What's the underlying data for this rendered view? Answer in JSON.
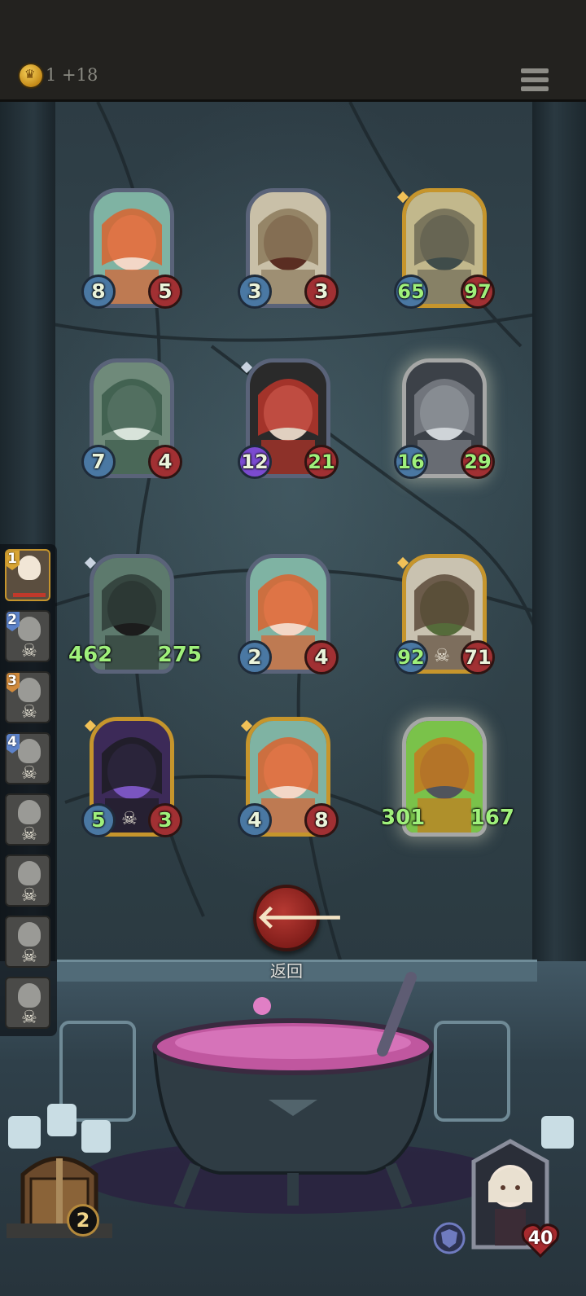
{
  "header": {
    "gold_text": "1 +18"
  },
  "board": {
    "rows": [
      [
        {
          "name": "siren-sorceress",
          "frame": "silver",
          "attack": "8",
          "health": "5"
        },
        {
          "name": "airship-bombardment",
          "frame": "silver",
          "attack": "3",
          "health": "3"
        },
        {
          "name": "kraken-shipwreck",
          "frame": "gold",
          "attack": "65",
          "health": "97"
        }
      ],
      [
        {
          "name": "horned-elf-sorceress",
          "frame": "silver",
          "attack": "7",
          "health": "4"
        },
        {
          "name": "hooded-assassin",
          "frame": "silver",
          "attack": "12",
          "health": "21"
        },
        {
          "name": "armored-gargoyle",
          "frame": "glowing",
          "attack": "16",
          "health": "29"
        }
      ],
      [
        {
          "name": "iron-knight-golem",
          "frame": "silver",
          "attack": "462",
          "health": "275"
        },
        {
          "name": "siren-sorceress",
          "frame": "silver",
          "attack": "2",
          "health": "4"
        },
        {
          "name": "old-hag",
          "frame": "gold",
          "attack": "92",
          "health": "71"
        }
      ],
      [
        {
          "name": "shadow-wraith",
          "frame": "gold",
          "attack": "5",
          "health": "3"
        },
        {
          "name": "siren-sorceress",
          "frame": "gold",
          "attack": "4",
          "health": "8"
        },
        {
          "name": "pumpkin-golem",
          "frame": "glowing",
          "attack": "301",
          "health": "167"
        }
      ]
    ]
  },
  "queue": [
    {
      "number": "1",
      "active": true
    },
    {
      "number": "2",
      "active": false
    },
    {
      "number": "3",
      "active": false
    },
    {
      "number": "4",
      "active": false
    },
    {
      "number": "",
      "active": false
    },
    {
      "number": "",
      "active": false
    },
    {
      "number": "",
      "active": false
    },
    {
      "number": "",
      "active": false
    }
  ],
  "back_button": {
    "label": "返回"
  },
  "chest": {
    "count": "2"
  },
  "hero": {
    "health": "40"
  },
  "colors": {
    "gold_frame": "#c6952c",
    "silver_frame": "#5a6379",
    "buffed_stat": "#9ff07b",
    "back_button": "#b73a33"
  },
  "icons": [
    "crown-coin-icon",
    "menu-icon",
    "skull-icon",
    "back-arrow-icon",
    "shield-icon",
    "chest-icon"
  ]
}
